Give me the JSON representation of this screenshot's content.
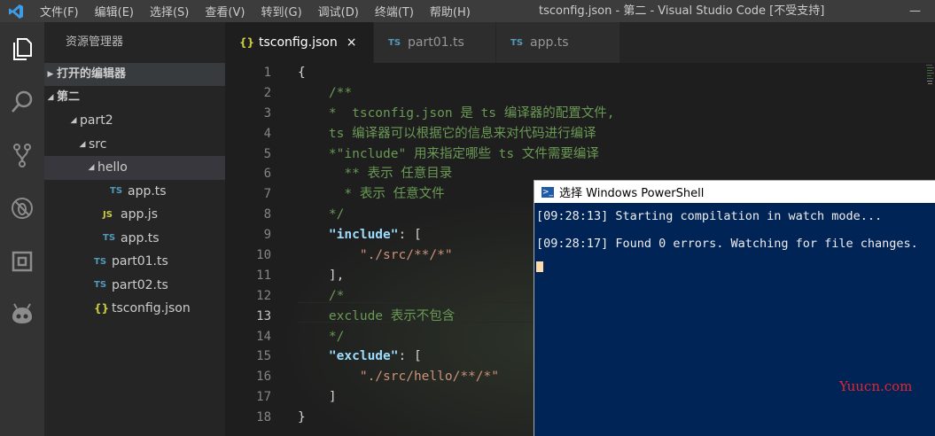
{
  "titlebar": {
    "menu": [
      "文件(F)",
      "编辑(E)",
      "选择(S)",
      "查看(V)",
      "转到(G)",
      "调试(D)",
      "终端(T)",
      "帮助(H)"
    ],
    "window_title": "tsconfig.json - 第二 - Visual Studio Code [不受支持]",
    "minimize": "—"
  },
  "sidebar": {
    "title": "资源管理器",
    "open_editors": "打开的编辑器",
    "workspace": "第二",
    "tree": [
      {
        "label": "part2",
        "kind": "folder",
        "depth": 1
      },
      {
        "label": "src",
        "kind": "folder",
        "depth": 2
      },
      {
        "label": "hello",
        "kind": "folder",
        "depth": 3
      },
      {
        "label": "app.ts",
        "kind": "ts",
        "depth": 4
      },
      {
        "label": "app.js",
        "kind": "js",
        "depth": 3
      },
      {
        "label": "app.ts",
        "kind": "ts",
        "depth": 3
      },
      {
        "label": "part01.ts",
        "kind": "ts",
        "depth": 2
      },
      {
        "label": "part02.ts",
        "kind": "ts",
        "depth": 2
      },
      {
        "label": "tsconfig.json",
        "kind": "json",
        "depth": 2
      }
    ],
    "icon_labels": {
      "ts": "TS",
      "js": "JS",
      "json": "{}"
    }
  },
  "tabs": [
    {
      "label": "tsconfig.json",
      "icon": "{}",
      "active": true,
      "close": "×"
    },
    {
      "label": "part01.ts",
      "icon": "TS",
      "active": false
    },
    {
      "label": "app.ts",
      "icon": "TS",
      "active": false
    }
  ],
  "editor": {
    "line_numbers": [
      "1",
      "2",
      "3",
      "4",
      "5",
      "6",
      "7",
      "8",
      "9",
      "10",
      "11",
      "12",
      "13",
      "14",
      "15",
      "16",
      "17",
      "18"
    ],
    "current_line": 13,
    "lines": [
      [
        {
          "t": "{",
          "c": "punc"
        }
      ],
      [
        {
          "t": "    /**",
          "c": "comment"
        }
      ],
      [
        {
          "t": "    *  tsconfig.json 是 ts 编译器的配置文件,",
          "c": "comment"
        }
      ],
      [
        {
          "t": "    ts 编译器可以根据它的信息来对代码进行编译",
          "c": "comment"
        }
      ],
      [
        {
          "t": "    *\"include\" 用来指定哪些 ts 文件需要编译",
          "c": "comment"
        }
      ],
      [
        {
          "t": "      ** 表示 任意目录",
          "c": "comment"
        }
      ],
      [
        {
          "t": "      * 表示 任意文件",
          "c": "comment"
        }
      ],
      [
        {
          "t": "    */",
          "c": "comment"
        }
      ],
      [
        {
          "t": "    \"include\"",
          "c": "key"
        },
        {
          "t": ": [",
          "c": "punc"
        }
      ],
      [
        {
          "t": "        \"./src/**/*\"",
          "c": "str"
        }
      ],
      [
        {
          "t": "    ],",
          "c": "punc"
        }
      ],
      [
        {
          "t": "    /*",
          "c": "comment"
        }
      ],
      [
        {
          "t": "    exclude 表示不包含",
          "c": "comment"
        }
      ],
      [
        {
          "t": "    */",
          "c": "comment"
        }
      ],
      [
        {
          "t": "    \"exclude\"",
          "c": "key"
        },
        {
          "t": ": [",
          "c": "punc"
        }
      ],
      [
        {
          "t": "        \"./src/hello/**/*\"",
          "c": "str"
        }
      ],
      [
        {
          "t": "    ]",
          "c": "punc"
        }
      ],
      [
        {
          "t": "}",
          "c": "punc"
        }
      ]
    ]
  },
  "powershell": {
    "title": "选择 Windows PowerShell",
    "lines": [
      "[09:28:13] Starting compilation in watch mode...",
      "[09:28:17] Found 0 errors. Watching for file changes."
    ]
  },
  "watermark": "Yuucn.com"
}
